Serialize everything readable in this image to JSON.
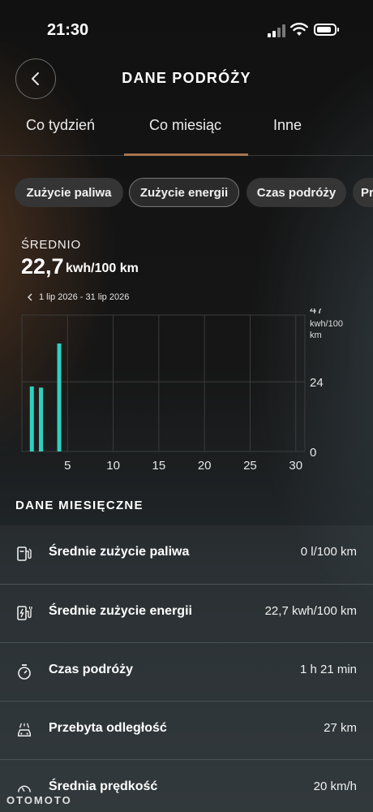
{
  "status": {
    "time": "21:30"
  },
  "header": {
    "title": "DANE PODRÓŻY"
  },
  "tabs": [
    {
      "label": "Co tydzień"
    },
    {
      "label": "Co miesiąc",
      "active": true
    },
    {
      "label": "Inne"
    }
  ],
  "chips": [
    {
      "label": "Zużycie paliwa"
    },
    {
      "label": "Zużycie energii",
      "active": true
    },
    {
      "label": "Czas podróży"
    },
    {
      "label": "Pr"
    }
  ],
  "summary": {
    "label": "ŚREDNIO",
    "value": "22,7",
    "unit": "kwh/100 km"
  },
  "range": {
    "label": "1 lip 2026 - 31 lip 2026"
  },
  "chart_data": {
    "type": "bar",
    "x": [
      1,
      2,
      4
    ],
    "values": [
      22.4,
      22.0,
      37.2
    ],
    "xlim": [
      0,
      31
    ],
    "ylim": [
      0,
      47
    ],
    "x_ticks": [
      "5",
      "10",
      "15",
      "20",
      "25",
      "30"
    ],
    "x_tick_values": [
      5,
      10,
      15,
      20,
      25,
      30
    ],
    "y_ticks": [
      "0",
      "24",
      "47"
    ],
    "y_tick_values": [
      0,
      24,
      47
    ],
    "ylabel": "kwh/100\nkm",
    "bar_color": "#2ed1c0",
    "grid": true
  },
  "section": {
    "title": "DANE MIESIĘCZNE"
  },
  "stats": [
    {
      "icon": "fuel-pump-icon",
      "label": "Średnie zużycie paliwa",
      "value": "0 l/100 km"
    },
    {
      "icon": "charging-station-icon",
      "label": "Średnie zużycie energii",
      "value": "22,7 kwh/100 km"
    },
    {
      "icon": "stopwatch-icon",
      "label": "Czas podróży",
      "value": "1 h 21 min"
    },
    {
      "icon": "car-road-icon",
      "label": "Przebyta odległość",
      "value": "27 km"
    },
    {
      "icon": "speedometer-icon",
      "label": "Średnia prędkość",
      "value": "20 km/h"
    }
  ],
  "watermark": "OTOMOTO"
}
